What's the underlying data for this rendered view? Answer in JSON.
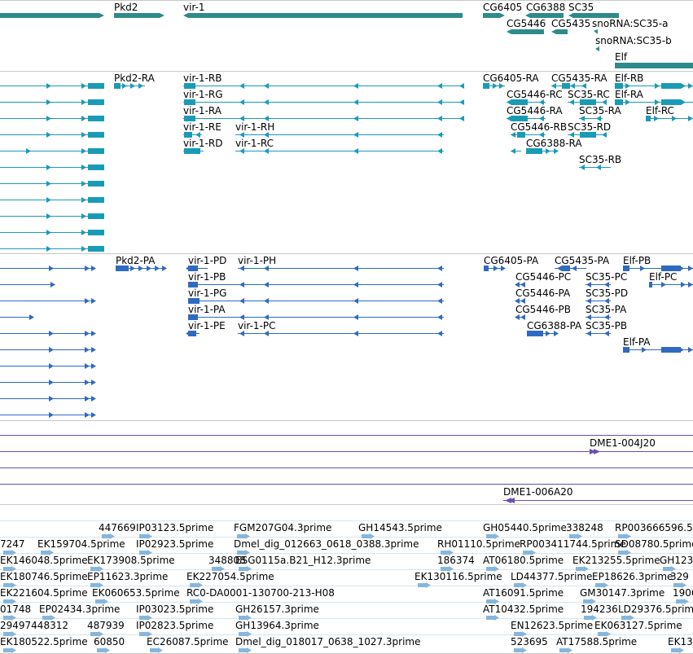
{
  "colors": {
    "gene": "#2e8b8b",
    "transcript_fb": "#1a9bb5",
    "transcript_rs": "#2f6ac0",
    "clone": "#6a4fb0",
    "est": "#86b6dc",
    "separator": "#c8c8c8"
  },
  "gene_track": {
    "labels": [
      "Pkd2",
      "vir-1",
      "CG6405",
      "CG6388",
      "SC35",
      "CG5446",
      "CG5435",
      "snoRNA:SC35-a",
      "snoRNA:SC35-b",
      "Elf"
    ]
  },
  "flybase_transcripts": {
    "labels": [
      "Pkd2-RA",
      "vir-1-RB",
      "vir-1-RG",
      "vir-1-RA",
      "vir-1-RE",
      "vir-1-RH",
      "vir-1-RD",
      "vir-1-RC",
      "CG6405-RA",
      "CG5435-RA",
      "Elf-RB",
      "CG5446-RC",
      "SC35-RC",
      "Elf-RA",
      "CG5446-RA",
      "SC35-RA",
      "Elf-RC",
      "CG5446-RB",
      "SC35-RD",
      "CG6388-RA",
      "SC35-RB"
    ]
  },
  "refseq_transcripts": {
    "labels": [
      "Pkd2-PA",
      "vir-1-PD",
      "vir-1-PH",
      "vir-1-PB",
      "vir-1-PG",
      "vir-1-PA",
      "vir-1-PE",
      "vir-1-PC",
      "CG6405-PA",
      "CG5435-PA",
      "Elf-PB",
      "CG5446-PC",
      "SC35-PC",
      "Elf-PC",
      "CG5446-PA",
      "SC35-PD",
      "CG5446-PB",
      "SC35-PA",
      "CG6388-PA",
      "SC35-PB",
      "Elf-PA"
    ]
  },
  "clones": {
    "labels": [
      "DME1-004J20",
      "DME1-006A20"
    ]
  },
  "ests": {
    "labels": [
      "447669",
      "IP03123.5prime",
      "FGM207G04.3prime",
      "GH14543.5prime",
      "GH05440.5prime",
      "338248",
      "RP003666596.5",
      "7247",
      "EK159704.5prime",
      "IP02923.5prime",
      "Dmel_dig_012663_0618_0388.3prime",
      "RH01110.5prime",
      "RP003411744.5prime",
      "SD08780.5prime",
      "EK146048.5prime",
      "EK173908.5prime",
      "348808",
      "ESG0115a.B21_H12.3prime",
      "186374",
      "AT06180.5prime",
      "EK213255.5prime",
      "GH123",
      "EK180746.5prime",
      "EP11623.3prime",
      "EK227054.5prime",
      "EK130116.5prime",
      "LD44377.5prime",
      "EP18626.3prime",
      "329",
      "EK221604.5prime",
      "EK060653.5prime",
      "RC0-DA0001-130700-213-H08",
      "AT16091.5prime",
      "GM30147.3prime",
      "1906",
      "01748",
      "EP02434.3prime",
      "IP03023.5prime",
      "GH26157.3prime",
      "AT10432.5prime",
      "194236",
      "LD29376.5prime",
      "29497448312",
      "487939",
      "IP02823.5prime",
      "GH13964.3prime",
      "EN12623.5prime",
      "EK063127.5prime",
      "EK180522.5prime",
      "60850",
      "EC26087.5prime",
      "Dmel_dig_018017_0638_1027.3prime",
      "523695",
      "AT17588.5prime",
      "EK13"
    ]
  }
}
